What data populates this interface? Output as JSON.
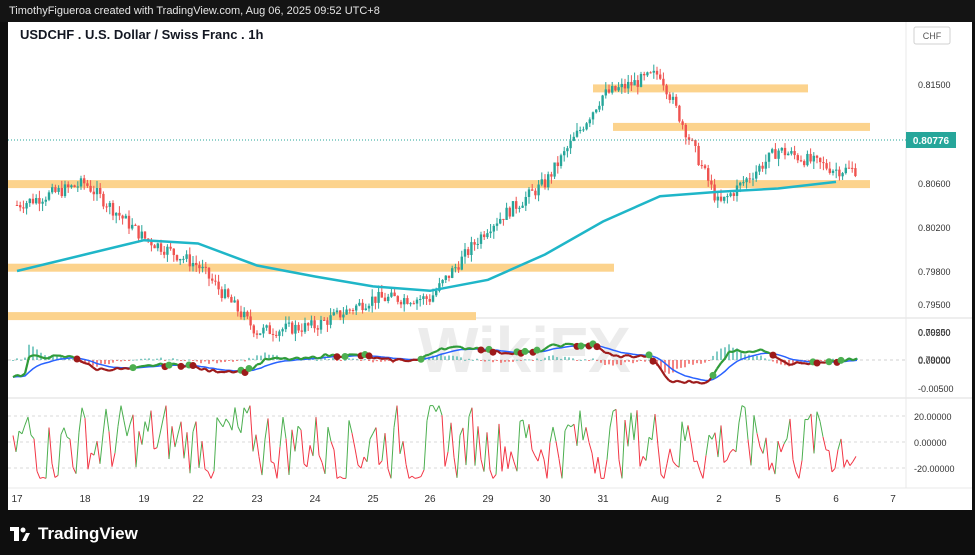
{
  "header": {
    "creator_line": "TimothyFigueroa created with TradingView.com, Aug 06, 2025 09:52 UTC+8"
  },
  "chart_title": "USDCHF . U.S. Dollar / Swiss Franc . 1h",
  "currency_badge": "CHF",
  "watermark_text": "WikiFX",
  "footer": {
    "brand": "TradingView"
  },
  "colors": {
    "up_candle": "#26a69a",
    "down_candle": "#ef5350",
    "moving_average": "#1fb6c8",
    "zones": "#fcd38d",
    "macd_fast": "#2f9b38",
    "macd_slow": "#9d1a1a",
    "signal_blue": "#2962ff",
    "osc_up": "#4caf50",
    "osc_down": "#f23645"
  },
  "chart_data": [
    {
      "type": "candlestick",
      "title": "USDCHF . U.S. Dollar / Swiss Franc . 1h",
      "x_ticks": [
        "17",
        "18",
        "19",
        "22",
        "23",
        "24",
        "25",
        "26",
        "29",
        "30",
        "31",
        "Aug",
        "2",
        "5",
        "6",
        "7"
      ],
      "y_ticks": [
        "0.81500",
        "0.81000",
        "0.80600",
        "0.80200",
        "0.79800",
        "0.79500",
        "0.79250",
        "0.79000"
      ],
      "last_price": "0.80776",
      "support_resistance_zones": [
        0.8146,
        0.8111,
        0.8059,
        0.7983,
        0.7939
      ],
      "moving_average_waypoints": [
        {
          "x": "17",
          "y": 0.798
        },
        {
          "x": "18",
          "y": 0.7995
        },
        {
          "x": "19",
          "y": 0.8008
        },
        {
          "x": "22",
          "y": 0.8005
        },
        {
          "x": "23",
          "y": 0.7985
        },
        {
          "x": "24",
          "y": 0.7975
        },
        {
          "x": "25",
          "y": 0.7966
        },
        {
          "x": "26",
          "y": 0.7962
        },
        {
          "x": "29",
          "y": 0.7972
        },
        {
          "x": "30",
          "y": 0.7995
        },
        {
          "x": "31",
          "y": 0.8025
        },
        {
          "x": "Aug",
          "y": 0.8048
        },
        {
          "x": "2",
          "y": 0.8052
        },
        {
          "x": "5",
          "y": 0.8055
        },
        {
          "x": "6",
          "y": 0.8061
        }
      ],
      "price_path_waypoints": [
        {
          "x": "17",
          "y": 0.804
        },
        {
          "x": "18",
          "y": 0.806
        },
        {
          "x": "19",
          "y": 0.801
        },
        {
          "x": "22",
          "y": 0.7985
        },
        {
          "x": "23",
          "y": 0.7925
        },
        {
          "x": "24",
          "y": 0.793
        },
        {
          "x": "25",
          "y": 0.7955
        },
        {
          "x": "26",
          "y": 0.7955
        },
        {
          "x": "29",
          "y": 0.802
        },
        {
          "x": "30",
          "y": 0.806
        },
        {
          "x": "31",
          "y": 0.814
        },
        {
          "x": "Aug",
          "y": 0.816
        },
        {
          "x": "2",
          "y": 0.804
        },
        {
          "x": "5",
          "y": 0.809
        },
        {
          "x": "6",
          "y": 0.8072
        }
      ]
    },
    {
      "type": "line",
      "name": "MACD panel",
      "y_ticks": [
        "0.00500",
        "0.00000",
        "-0.00500"
      ],
      "ylim": [
        -0.0075,
        0.0075
      ]
    },
    {
      "type": "line",
      "name": "Oscillator panel",
      "y_ticks": [
        "20.00000",
        "0.00000",
        "-20.00000"
      ],
      "ylim": [
        -30,
        30
      ]
    }
  ]
}
